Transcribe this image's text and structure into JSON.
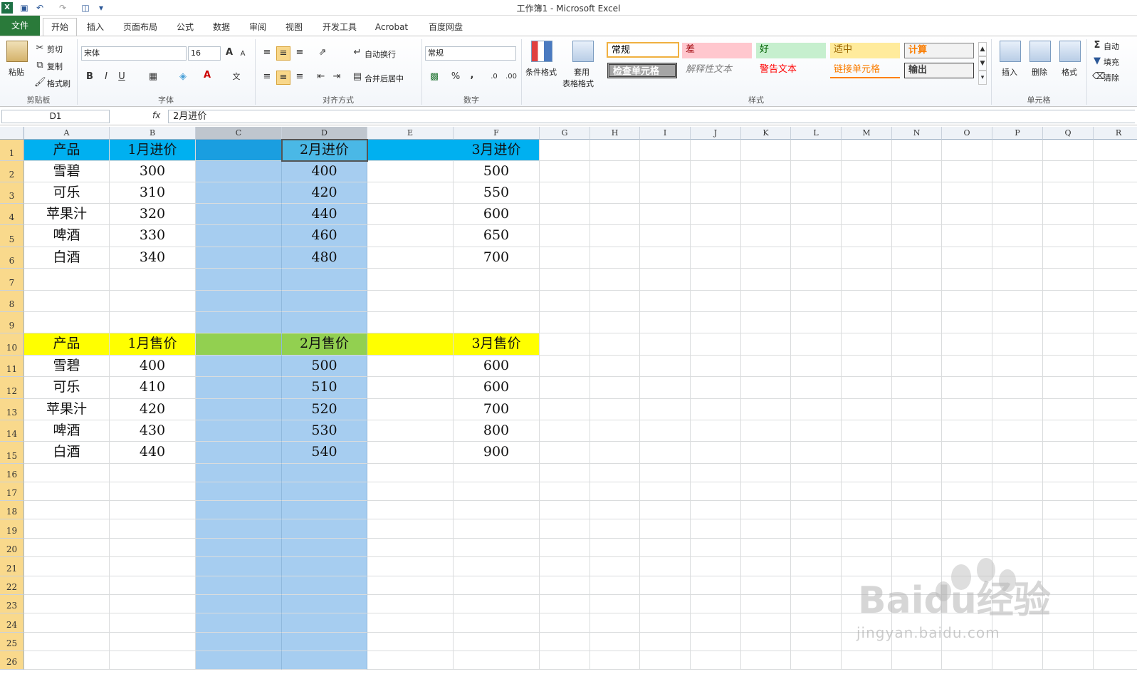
{
  "window": {
    "title": "工作簿1 - Microsoft Excel"
  },
  "tabs": [
    "文件",
    "开始",
    "插入",
    "页面布局",
    "公式",
    "数据",
    "审阅",
    "视图",
    "开发工具",
    "Acrobat",
    "百度网盘"
  ],
  "ribbon": {
    "clipboard": {
      "paste": "粘贴",
      "cut": "剪切",
      "copy": "复制",
      "format_painter": "格式刷",
      "label": "剪贴板"
    },
    "font": {
      "name": "宋体",
      "size": "16",
      "bold": "B",
      "italic": "I",
      "underline": "U",
      "label": "字体"
    },
    "alignment": {
      "wrap": "自动换行",
      "merge": "合并后居中",
      "label": "对齐方式"
    },
    "number": {
      "format": "常规",
      "percent": "%",
      "comma": ",",
      "label": "数字"
    },
    "styles": {
      "cond_format": "条件格式",
      "table_format_1": "套用",
      "table_format_2": "表格格式",
      "cells": [
        "常规",
        "差",
        "好",
        "适中",
        "计算",
        "检查单元格",
        "解释性文本",
        "警告文本",
        "链接单元格",
        "输出"
      ],
      "label": "样式"
    },
    "cells": {
      "insert": "插入",
      "delete": "删除",
      "format": "格式",
      "label": "单元格"
    },
    "editing": {
      "autosum": "自动",
      "fill": "填充",
      "clear": "清除"
    }
  },
  "formula_bar": {
    "name_box": "D1",
    "fx": "fx",
    "content": "2月进价"
  },
  "columns": [
    "A",
    "B",
    "C",
    "D",
    "E",
    "F",
    "G",
    "H",
    "I",
    "J",
    "K",
    "L",
    "M",
    "N",
    "O",
    "P",
    "Q",
    "R"
  ],
  "rows": [
    "1",
    "2",
    "3",
    "4",
    "5",
    "6",
    "7",
    "8",
    "9",
    "10",
    "11",
    "12",
    "13",
    "14",
    "15",
    "16",
    "17",
    "18",
    "19",
    "20",
    "21",
    "22",
    "23",
    "24",
    "25",
    "26"
  ],
  "table1": {
    "headers": [
      "产品",
      "1月进价",
      "",
      "2月进价",
      "",
      "3月进价"
    ],
    "rows": [
      [
        "雪碧",
        "300",
        "",
        "400",
        "",
        "500"
      ],
      [
        "可乐",
        "310",
        "",
        "420",
        "",
        "550"
      ],
      [
        "苹果汁",
        "320",
        "",
        "440",
        "",
        "600"
      ],
      [
        "啤酒",
        "330",
        "",
        "460",
        "",
        "650"
      ],
      [
        "白酒",
        "340",
        "",
        "480",
        "",
        "700"
      ]
    ]
  },
  "table2": {
    "headers": [
      "产品",
      "1月售价",
      "",
      "2月售价",
      "",
      "3月售价"
    ],
    "rows": [
      [
        "雪碧",
        "400",
        "",
        "500",
        "",
        "600"
      ],
      [
        "可乐",
        "410",
        "",
        "510",
        "",
        "600"
      ],
      [
        "苹果汁",
        "420",
        "",
        "520",
        "",
        "700"
      ],
      [
        "啤酒",
        "430",
        "",
        "530",
        "",
        "800"
      ],
      [
        "白酒",
        "440",
        "",
        "540",
        "",
        "900"
      ]
    ]
  },
  "colors": {
    "header_blue": "#00b0f0",
    "header_yellow": "#ffff00",
    "header_green": "#92d050",
    "col_fill": "#a6cdf0",
    "file_tab": "#2a7a3a"
  },
  "watermark": {
    "text": "Baidu经验",
    "url": "jingyan.baidu.com"
  }
}
